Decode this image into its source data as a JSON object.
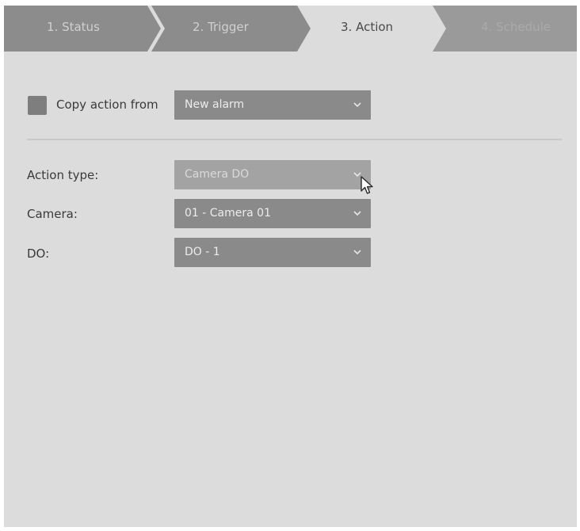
{
  "wizard": {
    "steps": [
      {
        "label": "1. Status",
        "state": "done"
      },
      {
        "label": "2. Trigger",
        "state": "done"
      },
      {
        "label": "3. Action",
        "state": "active"
      },
      {
        "label": "4. Schedule",
        "state": "future"
      }
    ]
  },
  "copy_action": {
    "checked": true,
    "label": "Copy action from",
    "selected": "New alarm"
  },
  "form": {
    "action_type": {
      "label": "Action type:",
      "value": "Camera DO"
    },
    "camera": {
      "label": "Camera:",
      "value": "01 - Camera 01"
    },
    "do": {
      "label": "DO:",
      "value": "DO - 1"
    }
  },
  "icons": {
    "dropdown": "chevron-down-icon",
    "cursor": "mouse-cursor-icon"
  },
  "colors": {
    "panel_bg": "#dcdcdc",
    "step_done_bg": "#8c8c8c",
    "step_future_bg": "#9a9a9a",
    "step_active_bg": "#dcdcdc",
    "dropdown_bg": "#8a8a8a",
    "checkbox_bg": "#7e7e7e"
  }
}
